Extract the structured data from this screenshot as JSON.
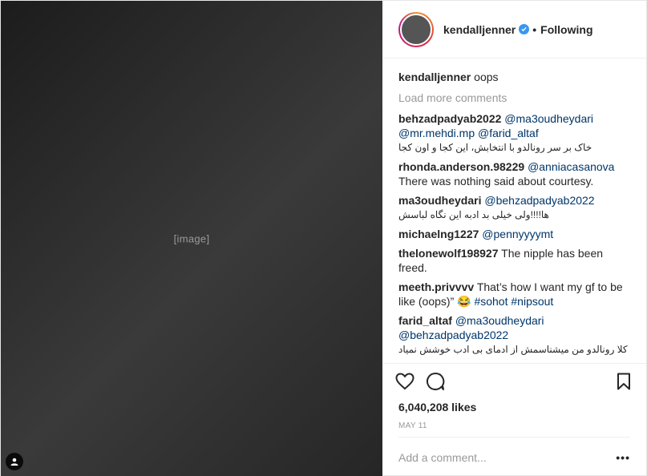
{
  "media": {
    "placeholder_note": "[image]"
  },
  "header": {
    "username": "kendalljenner",
    "separator": "•",
    "follow_status": "Following"
  },
  "caption": {
    "username": "kendalljenner",
    "text": "oops"
  },
  "load_more_label": "Load more comments",
  "comments": [
    {
      "username": "behzadpadyab2022",
      "mentions": [
        "@ma3oudheydari",
        "@mr.mehdi.mp",
        "@farid_altaf"
      ],
      "text": "خاک بر سر رونالدو با انتخابش، این کجا و اون کجا"
    },
    {
      "username": "rhonda.anderson.98229",
      "mentions": [
        "@anniacasanova"
      ],
      "text": "There was nothing said about courtesy."
    },
    {
      "username": "ma3oudheydari",
      "mentions": [
        "@behzadpadyab2022"
      ],
      "text": "ها!!!!ولی خیلی بد ادبه این نگاه لباسش"
    },
    {
      "username": "michaelng1227",
      "mentions": [
        "@pennyyyymt"
      ],
      "text": ""
    },
    {
      "username": "thelonewolf198927",
      "mentions": [],
      "text": "The nipple has been freed."
    },
    {
      "username": "meeth.privvvv",
      "mentions": [],
      "text": "That’s how I want my gf to be like (oops)” 😂",
      "hashtags": [
        "#sohot",
        "#nipsout"
      ]
    },
    {
      "username": "farid_altaf",
      "mentions": [
        "@ma3oudheydari",
        "@behzadpadyab2022"
      ],
      "text": "کلا رونالدو من میشناسمش از ادمای بی ادب خوشش نمیاد"
    }
  ],
  "likes": "6,040,208 likes",
  "date": "MAY 11",
  "add_comment": {
    "placeholder": "Add a comment...",
    "more_label": "•••"
  },
  "colors": {
    "link": "#003569",
    "muted": "#999999",
    "verified": "#3897f0"
  },
  "icons": {
    "heart": "heart-icon",
    "comment": "comment-icon",
    "bookmark": "bookmark-icon",
    "tag": "user-tag-icon",
    "verified": "verified-badge-icon"
  }
}
